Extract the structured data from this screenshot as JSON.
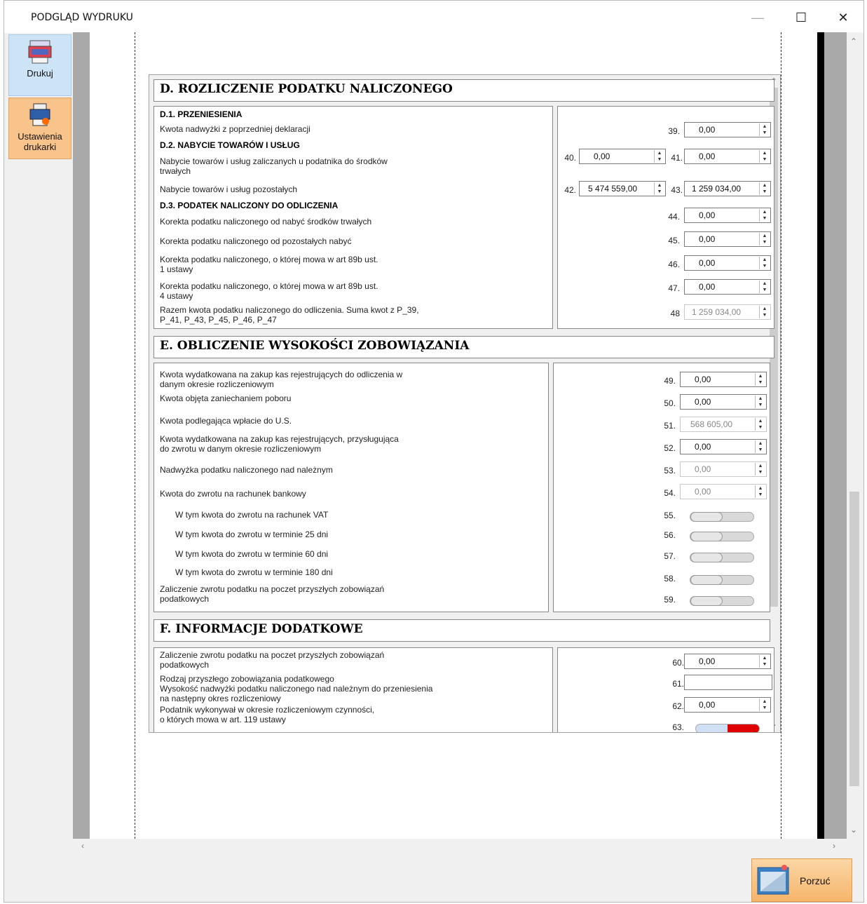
{
  "window": {
    "title": "PODGLĄD WYDRUKU",
    "minimize": "—",
    "maximize": "☐",
    "close": "✕"
  },
  "sidebar": {
    "print_label": "Drukuj",
    "printer_settings_label_1": "Ustawienia",
    "printer_settings_label_2": "drukarki"
  },
  "sectionD": {
    "title": "D. ROZLICZENIE PODATKU NALICZONEGO",
    "d1": "D.1. PRZENIESIENIA",
    "carry_over_label": "Kwota nadwyżki z poprzedniej deklaracji",
    "d2": "D.2. NABYCIE TOWARÓW I USŁUG",
    "fixed_assets_label_1": "Nabycie towarów i usług zaliczanych u podatnika do środków",
    "fixed_assets_label_2": "trwałych",
    "other_label": "Nabycie towarów i usług pozostałych",
    "d3": "D.3. PODATEK NALICZONY DO ODLICZENIA",
    "corr_fixed_label": "Korekta podatku naliczonego od nabyć środków trwałych",
    "corr_other_label": "Korekta podatku naliczonego od pozostałych nabyć",
    "corr_89b1_label_1": "Korekta podatku naliczonego, o której mowa w art 89b ust.",
    "corr_89b1_label_2": "1 ustawy",
    "corr_89b4_label_1": "Korekta podatku naliczonego, o której mowa w art 89b ust.",
    "corr_89b4_label_2": "4 ustawy",
    "total_label_1": "Razem kwota podatku naliczonego do odliczenia. Suma kwot z P_39,",
    "total_label_2": "P_41, P_43, P_45, P_46, P_47",
    "n39": "39.",
    "v39": "0,00",
    "n40": "40.",
    "v40": "0,00",
    "n41": "41.",
    "v41": "0,00",
    "n42": "42.",
    "v42": "5 474 559,00",
    "n43": "43.",
    "v43": "1 259 034,00",
    "n44": "44.",
    "v44": "0,00",
    "n45": "45.",
    "v45": "0,00",
    "n46": "46.",
    "v46": "0,00",
    "n47": "47.",
    "v47": "0,00",
    "n48": "48",
    "v48": "1 259 034,00"
  },
  "sectionE": {
    "title": "E. OBLICZENIE WYSOKOŚCI ZOBOWIĄZANIA",
    "l49_1": "Kwota wydatkowana na zakup kas rejestrujących do odliczenia w",
    "l49_2": "danym okresie rozliczeniowym",
    "l50": "Kwota objęta zaniechaniem poboru",
    "l51": "Kwota podlegająca wpłacie do U.S.",
    "l52_1": "Kwota wydatkowana na zakup kas rejestrujących, przysługująca",
    "l52_2": "do zwrotu w danym okresie rozliczeniowym",
    "l53": "Nadwyżka podatku naliczonego nad należnym",
    "l54": "Kwota do zwrotu na rachunek bankowy",
    "l55": "W tym kwota do zwrotu na rachunek VAT",
    "l56": "W tym kwota do zwrotu w terminie 25 dni",
    "l57": "W tym kwota do zwrotu w terminie 60 dni",
    "l58": "W tym kwota do zwrotu w terminie 180 dni",
    "l59_1": "Zaliczenie zwrotu podatku na poczet przyszłych zobowiązań",
    "l59_2": "podatkowych",
    "n49": "49.",
    "v49": "0,00",
    "n50": "50.",
    "v50": "0,00",
    "n51": "51.",
    "v51": "568 605,00",
    "n52": "52.",
    "v52": "0,00",
    "n53": "53.",
    "v53": "0,00",
    "n54": "54.",
    "v54": "0,00",
    "n55": "55.",
    "n56": "56.",
    "n57": "57.",
    "n58": "58.",
    "n59": "59."
  },
  "sectionF": {
    "title": "F. INFORMACJE DODATKOWE",
    "l60_1": "Zaliczenie zwrotu podatku na poczet przyszłych zobowiązań",
    "l60_2": "podatkowych",
    "l61": "Rodzaj przyszłego zobowiązania podatkowego",
    "l62_1": "Wysokość nadwyżki podatku naliczonego nad należnym do przeniesienia",
    "l62_2": "na następny okres rozliczeniowy",
    "l63_1": "Podatnik wykonywał w okresie rozliczeniowym czynności,",
    "l63_2": "o których mowa w art. 119 ustawy",
    "n60": "60.",
    "v60": "0,00",
    "n61": "61.",
    "v61": "",
    "n62": "62.",
    "v62": "0,00",
    "n63": "63."
  },
  "footer": {
    "discard_label": "Porzuć"
  }
}
